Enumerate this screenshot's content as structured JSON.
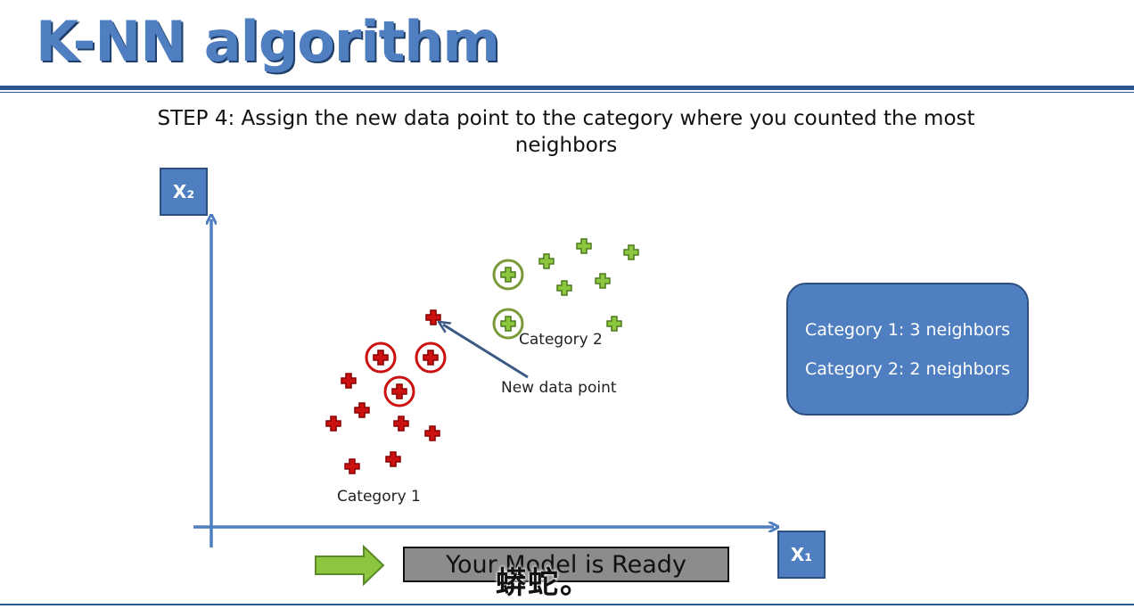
{
  "title": "K-NN algorithm",
  "step": {
    "label": "STEP 4",
    "text": ": Assign the new data point to the category where you counted the most neighbors"
  },
  "axes": {
    "x_label": "X₁",
    "y_label": "X₂"
  },
  "labels": {
    "category1": "Category 1",
    "category2": "Category 2",
    "new_point": "New data point"
  },
  "counts": {
    "line1": "Category 1: 3 neighbors",
    "line2": "Category 2: 2 neighbors"
  },
  "banner": {
    "text": "Your Model is Ready"
  },
  "subtitle": "蟒蛇。",
  "colors": {
    "category1": "#cc1111",
    "category2": "#8cc63f",
    "axis": "#4f7fc0",
    "title": "#4f7fc0",
    "panel": "#4f7fc0"
  },
  "chart_data": {
    "type": "scatter",
    "series": [
      {
        "name": "Category 1",
        "marker": "plus",
        "color": "#cc1111",
        "points": [
          [
            391,
            427
          ],
          [
            406,
            460
          ],
          [
            374,
            475
          ],
          [
            450,
            475
          ],
          [
            485,
            486
          ],
          [
            441,
            515
          ],
          [
            395,
            523
          ]
        ],
        "neighbors": [
          [
            427,
            401
          ],
          [
            483,
            401
          ],
          [
            448,
            439
          ]
        ]
      },
      {
        "name": "Category 2",
        "marker": "plus",
        "color": "#8cc63f",
        "points": [
          [
            613,
            293
          ],
          [
            655,
            276
          ],
          [
            708,
            283
          ],
          [
            676,
            315
          ],
          [
            633,
            323
          ],
          [
            689,
            363
          ]
        ],
        "neighbors": [
          [
            570,
            308
          ],
          [
            570,
            363
          ]
        ]
      }
    ],
    "new_point": {
      "x": 486,
      "y": 356
    }
  }
}
